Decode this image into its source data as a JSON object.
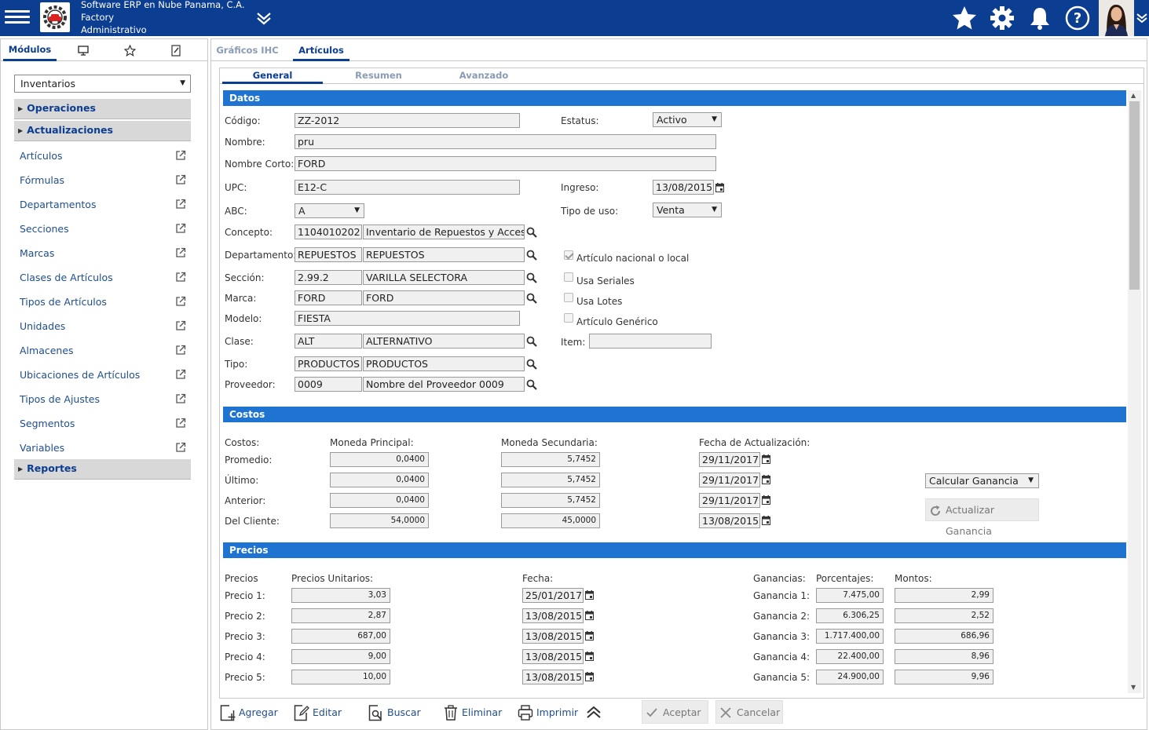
{
  "header": {
    "company_line1": "Software ERP en Nube Panama, C.A.",
    "company_line2": "Factory",
    "company_line3": "Administrativo",
    "icons": [
      "menu-icon",
      "chevron-down-icon",
      "star-icon",
      "gear-icon",
      "bell-icon",
      "help-icon"
    ]
  },
  "sidebar": {
    "tab_modulos": "Módulos",
    "module_select": "Inventarios",
    "sections": {
      "operaciones": "Operaciones",
      "actualizaciones": "Actualizaciones",
      "reportes": "Reportes"
    },
    "items": [
      "Artículos",
      "Fórmulas",
      "Departamentos",
      "Secciones",
      "Marcas",
      "Clases de Artículos",
      "Tipos de Artículos",
      "Unidades",
      "Almacenes",
      "Ubicaciones de Artículos",
      "Tipos de Ajustes",
      "Segmentos",
      "Variables"
    ]
  },
  "main": {
    "tabs": [
      "Gráficos IHC",
      "Artículos"
    ],
    "subtabs": [
      "General",
      "Resumen",
      "Avanzado"
    ]
  },
  "datos": {
    "title": "Datos",
    "codigo_label": "Código:",
    "codigo": "ZZ-2012",
    "estatus_label": "Estatus:",
    "estatus": "Activo",
    "nombre_label": "Nombre:",
    "nombre": "pru",
    "nombre_corto_label": "Nombre Corto:",
    "nombre_corto": "FORD",
    "upc_label": "UPC:",
    "upc": "E12-C",
    "ingreso_label": "Ingreso:",
    "ingreso": "13/08/2015",
    "abc_label": "ABC:",
    "abc": "A",
    "tipo_uso_label": "Tipo de uso:",
    "tipo_uso": "Venta",
    "concepto_label": "Concepto:",
    "concepto_code": "1104010202",
    "concepto_desc": "Inventario de Repuestos y Accesorios",
    "departamento_label": "Departamento:",
    "departamento_code": "REPUESTOS",
    "departamento_desc": "REPUESTOS",
    "seccion_label": "Sección:",
    "seccion_code": "2.99.2",
    "seccion_desc": "VARILLA SELECTORA",
    "marca_label": "Marca:",
    "marca_code": "FORD",
    "marca_desc": "FORD",
    "modelo_label": "Modelo:",
    "modelo": "FIESTA",
    "clase_label": "Clase:",
    "clase_code": "ALT",
    "clase_desc": "ALTERNATIVO",
    "tipo_label": "Tipo:",
    "tipo_code": "PRODUCTOS",
    "tipo_desc": "PRODUCTOS",
    "proveedor_label": "Proveedor:",
    "proveedor_code": "0009",
    "proveedor_desc": "Nombre del Proveedor 0009",
    "chk_nacional": "Artículo nacional o local",
    "chk_seriales": "Usa Seriales",
    "chk_lotes": "Usa Lotes",
    "chk_generico": "Artículo Genérico",
    "item_label": "Item:",
    "item": ""
  },
  "costos": {
    "title": "Costos",
    "col_costos": "Costos:",
    "col_principal": "Moneda Principal:",
    "col_secundaria": "Moneda Secundaria:",
    "col_fecha": "Fecha de Actualización:",
    "rows": [
      {
        "label": "Promedio:",
        "principal": "0,0400",
        "secundaria": "5,7452",
        "fecha": "29/11/2017"
      },
      {
        "label": "Último:",
        "principal": "0,0400",
        "secundaria": "5,7452",
        "fecha": "29/11/2017"
      },
      {
        "label": "Anterior:",
        "principal": "0,0400",
        "secundaria": "5,7452",
        "fecha": "29/11/2017"
      },
      {
        "label": "Del Cliente:",
        "principal": "54,0000",
        "secundaria": "45,0000",
        "fecha": "13/08/2015"
      }
    ],
    "calcular_ganancia": "Calcular Ganancia",
    "actualizar_ganancia": "Actualizar Ganancia"
  },
  "precios": {
    "title": "Precios",
    "col_precios": "Precios",
    "col_unitarios": "Precios Unitarios:",
    "col_fecha": "Fecha:",
    "col_ganancias": "Ganancias:",
    "col_porcentajes": "Porcentajes:",
    "col_montos": "Montos:",
    "rows": [
      {
        "label": "Precio 1:",
        "unitario": "3,03",
        "fecha": "25/01/2017",
        "ganancia": "Ganancia 1:",
        "porcentaje": "7.475,00",
        "monto": "2,99"
      },
      {
        "label": "Precio 2:",
        "unitario": "2,87",
        "fecha": "13/08/2015",
        "ganancia": "Ganancia 2:",
        "porcentaje": "6.306,25",
        "monto": "2,52"
      },
      {
        "label": "Precio 3:",
        "unitario": "687,00",
        "fecha": "13/08/2015",
        "ganancia": "Ganancia 3:",
        "porcentaje": "1.717.400,00",
        "monto": "686,96"
      },
      {
        "label": "Precio 4:",
        "unitario": "9,00",
        "fecha": "13/08/2015",
        "ganancia": "Ganancia 4:",
        "porcentaje": "22.400,00",
        "monto": "8,96"
      },
      {
        "label": "Precio 5:",
        "unitario": "10,00",
        "fecha": "13/08/2015",
        "ganancia": "Ganancia 5:",
        "porcentaje": "24.900,00",
        "monto": "9,96"
      }
    ]
  },
  "toolbar": {
    "agregar": "Agregar",
    "editar": "Editar",
    "buscar": "Buscar",
    "eliminar": "Eliminar",
    "imprimir": "Imprimir",
    "aceptar": "Aceptar",
    "cancelar": "Cancelar"
  },
  "colors": {
    "brand": "#0b3d91",
    "section_header": "#1f74d1",
    "link": "#1f4e8c"
  }
}
